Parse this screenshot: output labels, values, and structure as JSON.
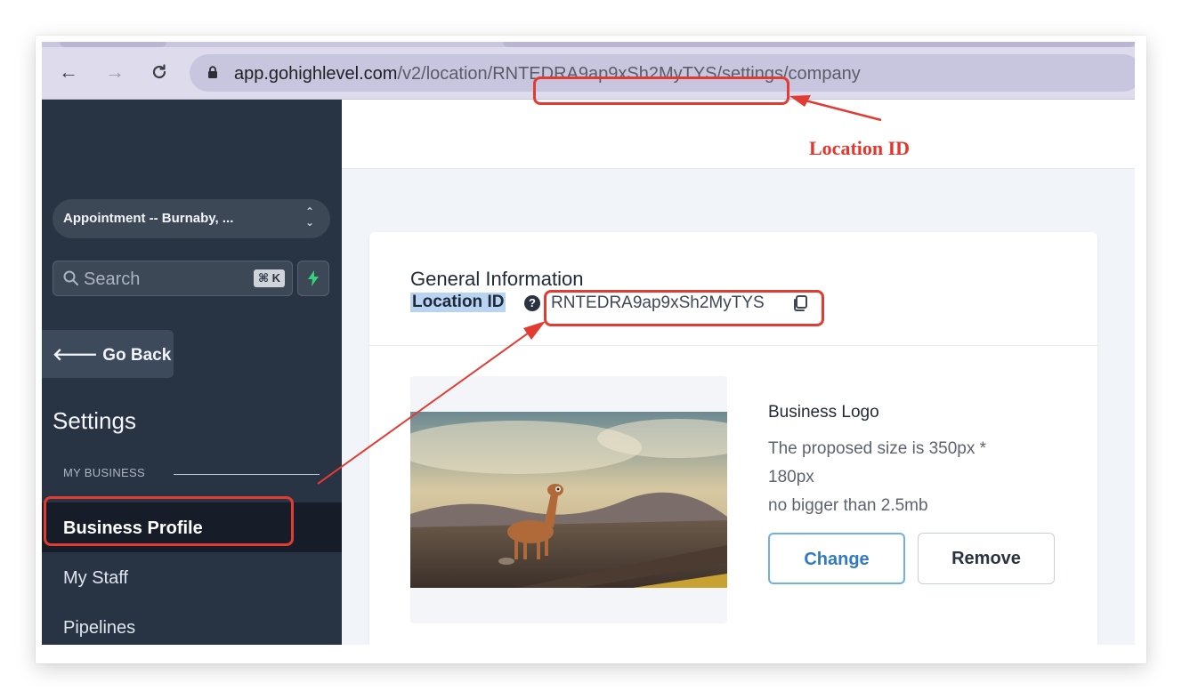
{
  "browser": {
    "url_host": "app.gohighlevel.com",
    "url_path": "/v2/location/RNTEDRA9ap9xSh2MyTYS/settings/company",
    "icons": [
      "back-arrow-icon",
      "forward-arrow-icon",
      "reload-icon",
      "lock-icon"
    ]
  },
  "sidebar": {
    "location_switcher": "Appointment -- Burnaby, ...",
    "search_placeholder": "Search",
    "search_shortcut": "⌘ K",
    "go_back": "Go Back",
    "title": "Settings",
    "section_label": "MY BUSINESS",
    "items": [
      {
        "label": "Business Profile",
        "active": true
      },
      {
        "label": "My Staff",
        "active": false
      },
      {
        "label": "Pipelines",
        "active": false
      }
    ]
  },
  "main": {
    "card_title": "General Information",
    "location_id_label": "Location ID",
    "location_id_value": "RNTEDRA9ap9xSh2MyTYS",
    "business_logo": {
      "title": "Business Logo",
      "desc_lines": [
        "The proposed size is 350px *",
        "180px",
        "no bigger than 2.5mb"
      ],
      "change_label": "Change",
      "remove_label": "Remove"
    }
  },
  "annotation": {
    "label": "Location ID",
    "color": "#e23b32"
  }
}
